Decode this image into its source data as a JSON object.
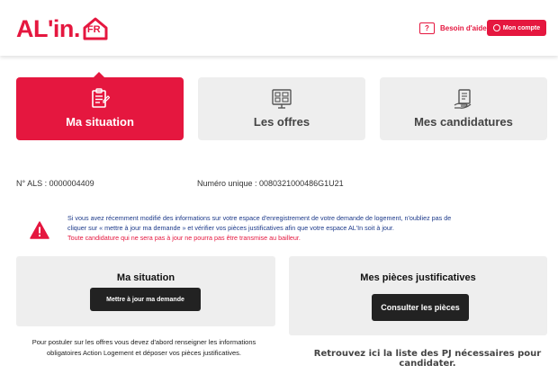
{
  "brand": {
    "logo_text": "AL'in.",
    "logo_badge": "FR",
    "accent": "#e5173f"
  },
  "header": {
    "help_label": "Besoin d'aide",
    "help_icon_glyph": "?",
    "account_label": "Mon compte"
  },
  "tabs": [
    {
      "label": "Ma situation",
      "icon": "clipboard-icon",
      "active": true
    },
    {
      "label": "Les offres",
      "icon": "listing-board-icon",
      "active": false
    },
    {
      "label": "Mes candidatures",
      "icon": "document-hand-icon",
      "active": false
    }
  ],
  "info": {
    "als": "N° ALS : 0000004409",
    "unique": "Numéro unique : 0080321000486G1U21"
  },
  "alert": {
    "line1": "Si vous avez récemment modifié des informations sur votre espace d'enregistrement de votre demande de logement, n'oubliez pas de",
    "line2": "cliquer sur « mettre à jour ma demande » et vérifier vos pièces justificatives afin que votre espace AL'In soit à jour.",
    "warning": "Toute candidature qui ne sera pas à jour ne pourra pas être transmise au bailleur."
  },
  "situation_card": {
    "title": "Ma situation",
    "button": "Mettre à jour ma demande",
    "description": "Pour postuler sur les offres vous devez d'abord renseigner les informations obligatoires Action Logement et déposer vos pièces justificatives."
  },
  "pieces_card": {
    "title": "Mes pièces justificatives",
    "button": "Consulter les pièces",
    "description": "Retrouvez ici la liste des PJ nécessaires pour candidater."
  }
}
